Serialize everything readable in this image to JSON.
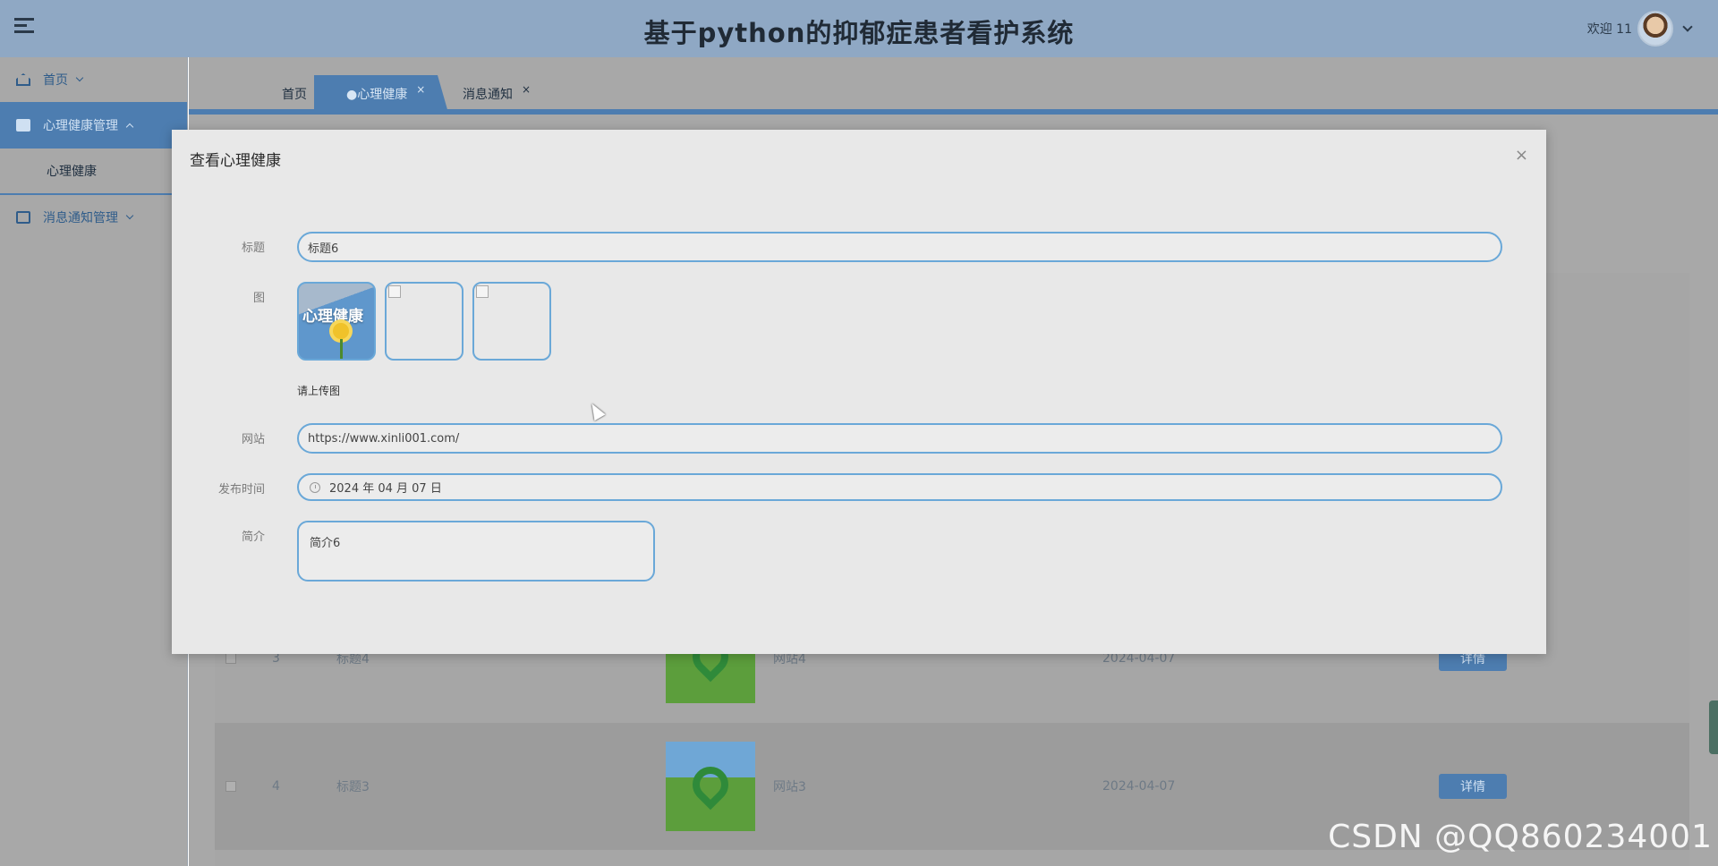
{
  "header": {
    "title": "基于python的抑郁症患者看护系统",
    "welcome": "欢迎 11"
  },
  "sidebar": {
    "items": [
      {
        "label": "首页"
      },
      {
        "label": "心理健康管理"
      },
      {
        "label": "心理健康"
      },
      {
        "label": "消息通知管理"
      }
    ]
  },
  "tabs": [
    {
      "label": "首页"
    },
    {
      "label": "●心理健康",
      "close": "×"
    },
    {
      "label": "消息通知",
      "close": "×"
    }
  ],
  "table": {
    "rows": [
      {
        "index": "3",
        "title": "标题4",
        "site": "网站4",
        "date": "2024-04-07",
        "action": "详情"
      },
      {
        "index": "4",
        "title": "标题3",
        "site": "网站3",
        "date": "2024-04-07",
        "action": "详情"
      }
    ]
  },
  "dialog": {
    "title": "查看心理健康",
    "close": "×",
    "fields": {
      "title_label": "标题",
      "title_value": "标题6",
      "image_label": "图",
      "image_text": "心理健康",
      "upload_hint": "请上传图",
      "site_label": "网站",
      "site_value": "https://www.xinli001.com/",
      "time_label": "发布时间",
      "time_value": "2024 年 04 月 07 日",
      "intro_label": "简介",
      "intro_value": "简介6"
    }
  },
  "watermark": "CSDN @QQ860234001"
}
